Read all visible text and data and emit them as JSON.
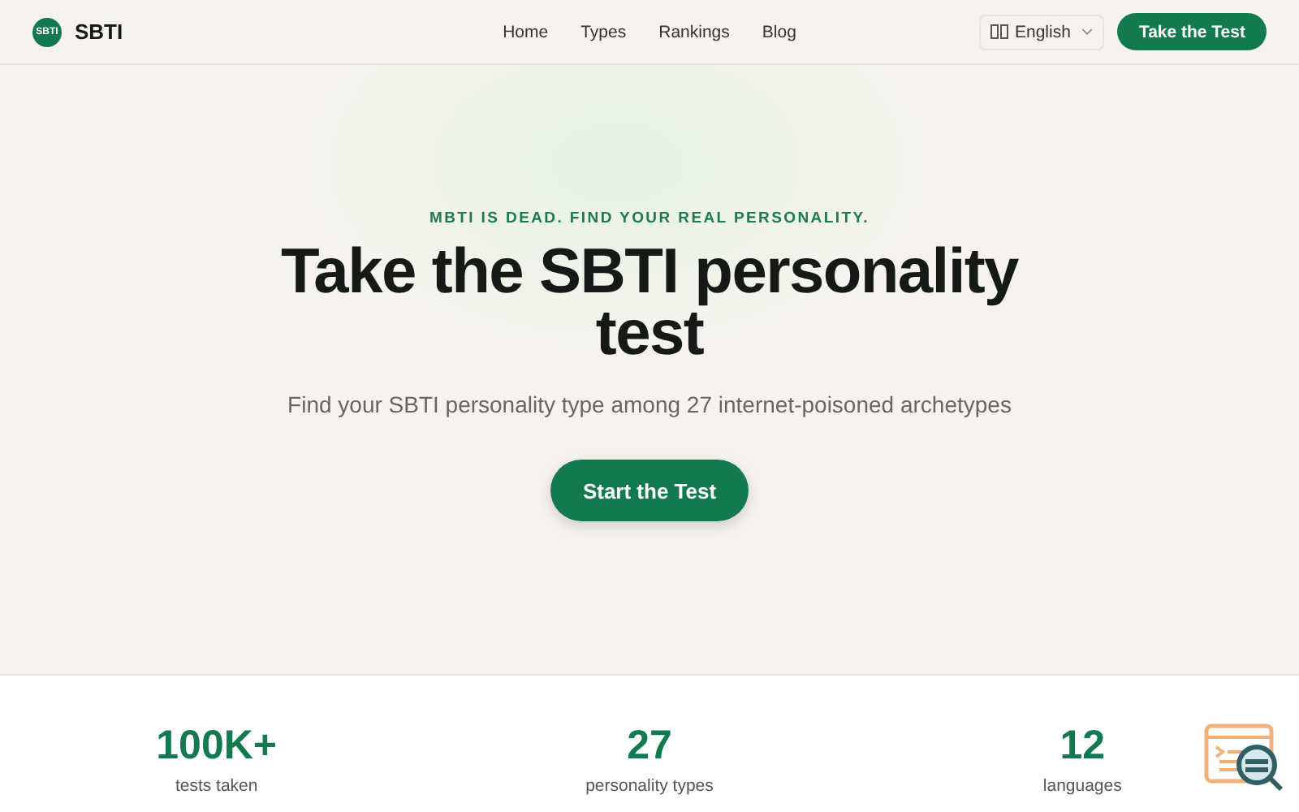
{
  "header": {
    "logo_mark": "SBTI",
    "brand": "SBTI",
    "nav": [
      {
        "label": "Home"
      },
      {
        "label": "Types"
      },
      {
        "label": "Rankings"
      },
      {
        "label": "Blog"
      }
    ],
    "language": "English",
    "cta": "Take the Test"
  },
  "hero": {
    "eyebrow": "MBTI IS DEAD. FIND YOUR REAL PERSONALITY.",
    "title": "Take the SBTI personality test",
    "subtitle": "Find your SBTI personality type among 27 internet-poisoned archetypes",
    "button": "Start the Test"
  },
  "stats": [
    {
      "value": "100K+",
      "label": "tests taken"
    },
    {
      "value": "27",
      "label": "personality types"
    },
    {
      "value": "12",
      "label": "languages"
    }
  ]
}
